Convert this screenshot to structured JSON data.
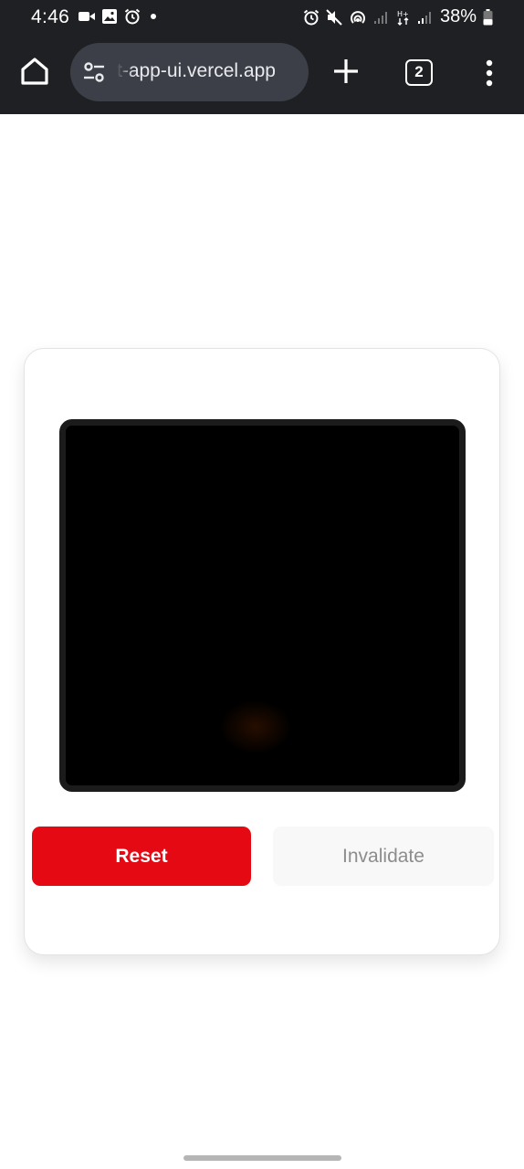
{
  "status_bar": {
    "time": "4:46",
    "left_icons": [
      "video-call-icon",
      "image-icon",
      "alarm-icon",
      "dot-icon"
    ],
    "right_icons": [
      "alarm-icon",
      "mute-icon",
      "hotspot-icon",
      "signal-icon",
      "network-type-icon",
      "signal-icon"
    ],
    "battery_percent": "38%"
  },
  "toolbar": {
    "url": "t-app-ui.vercel.app",
    "tab_count": "2",
    "icons": [
      "home-icon",
      "site-settings-icon",
      "plus-icon",
      "tabs-icon",
      "more-vert-icon"
    ]
  },
  "card": {
    "reset_label": "Reset",
    "invalidate_label": "Invalidate"
  },
  "colors": {
    "accent": "#e50914",
    "browser_chrome": "#1f2023",
    "url_bar": "#3c3f47"
  }
}
